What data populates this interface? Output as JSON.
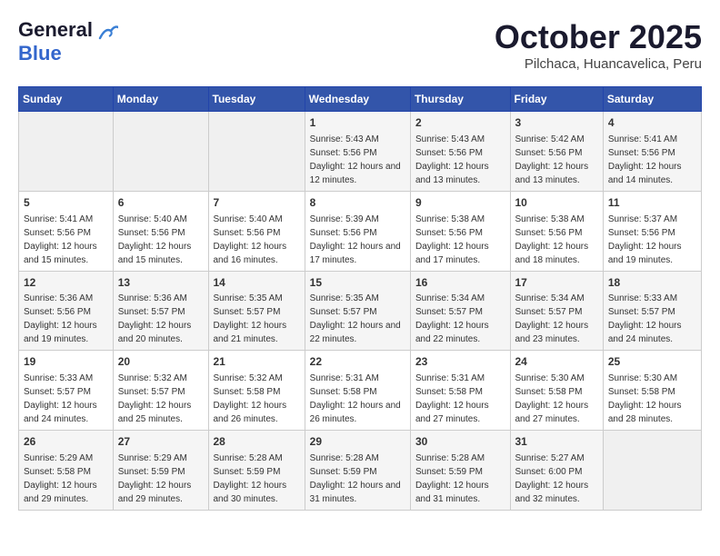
{
  "header": {
    "logo_general": "General",
    "logo_blue": "Blue",
    "month_year": "October 2025",
    "location": "Pilchaca, Huancavelica, Peru"
  },
  "weekdays": [
    "Sunday",
    "Monday",
    "Tuesday",
    "Wednesday",
    "Thursday",
    "Friday",
    "Saturday"
  ],
  "weeks": [
    [
      {
        "day": "",
        "sunrise": "",
        "sunset": "",
        "daylight": ""
      },
      {
        "day": "",
        "sunrise": "",
        "sunset": "",
        "daylight": ""
      },
      {
        "day": "",
        "sunrise": "",
        "sunset": "",
        "daylight": ""
      },
      {
        "day": "1",
        "sunrise": "Sunrise: 5:43 AM",
        "sunset": "Sunset: 5:56 PM",
        "daylight": "Daylight: 12 hours and 12 minutes."
      },
      {
        "day": "2",
        "sunrise": "Sunrise: 5:43 AM",
        "sunset": "Sunset: 5:56 PM",
        "daylight": "Daylight: 12 hours and 13 minutes."
      },
      {
        "day": "3",
        "sunrise": "Sunrise: 5:42 AM",
        "sunset": "Sunset: 5:56 PM",
        "daylight": "Daylight: 12 hours and 13 minutes."
      },
      {
        "day": "4",
        "sunrise": "Sunrise: 5:41 AM",
        "sunset": "Sunset: 5:56 PM",
        "daylight": "Daylight: 12 hours and 14 minutes."
      }
    ],
    [
      {
        "day": "5",
        "sunrise": "Sunrise: 5:41 AM",
        "sunset": "Sunset: 5:56 PM",
        "daylight": "Daylight: 12 hours and 15 minutes."
      },
      {
        "day": "6",
        "sunrise": "Sunrise: 5:40 AM",
        "sunset": "Sunset: 5:56 PM",
        "daylight": "Daylight: 12 hours and 15 minutes."
      },
      {
        "day": "7",
        "sunrise": "Sunrise: 5:40 AM",
        "sunset": "Sunset: 5:56 PM",
        "daylight": "Daylight: 12 hours and 16 minutes."
      },
      {
        "day": "8",
        "sunrise": "Sunrise: 5:39 AM",
        "sunset": "Sunset: 5:56 PM",
        "daylight": "Daylight: 12 hours and 17 minutes."
      },
      {
        "day": "9",
        "sunrise": "Sunrise: 5:38 AM",
        "sunset": "Sunset: 5:56 PM",
        "daylight": "Daylight: 12 hours and 17 minutes."
      },
      {
        "day": "10",
        "sunrise": "Sunrise: 5:38 AM",
        "sunset": "Sunset: 5:56 PM",
        "daylight": "Daylight: 12 hours and 18 minutes."
      },
      {
        "day": "11",
        "sunrise": "Sunrise: 5:37 AM",
        "sunset": "Sunset: 5:56 PM",
        "daylight": "Daylight: 12 hours and 19 minutes."
      }
    ],
    [
      {
        "day": "12",
        "sunrise": "Sunrise: 5:36 AM",
        "sunset": "Sunset: 5:56 PM",
        "daylight": "Daylight: 12 hours and 19 minutes."
      },
      {
        "day": "13",
        "sunrise": "Sunrise: 5:36 AM",
        "sunset": "Sunset: 5:57 PM",
        "daylight": "Daylight: 12 hours and 20 minutes."
      },
      {
        "day": "14",
        "sunrise": "Sunrise: 5:35 AM",
        "sunset": "Sunset: 5:57 PM",
        "daylight": "Daylight: 12 hours and 21 minutes."
      },
      {
        "day": "15",
        "sunrise": "Sunrise: 5:35 AM",
        "sunset": "Sunset: 5:57 PM",
        "daylight": "Daylight: 12 hours and 22 minutes."
      },
      {
        "day": "16",
        "sunrise": "Sunrise: 5:34 AM",
        "sunset": "Sunset: 5:57 PM",
        "daylight": "Daylight: 12 hours and 22 minutes."
      },
      {
        "day": "17",
        "sunrise": "Sunrise: 5:34 AM",
        "sunset": "Sunset: 5:57 PM",
        "daylight": "Daylight: 12 hours and 23 minutes."
      },
      {
        "day": "18",
        "sunrise": "Sunrise: 5:33 AM",
        "sunset": "Sunset: 5:57 PM",
        "daylight": "Daylight: 12 hours and 24 minutes."
      }
    ],
    [
      {
        "day": "19",
        "sunrise": "Sunrise: 5:33 AM",
        "sunset": "Sunset: 5:57 PM",
        "daylight": "Daylight: 12 hours and 24 minutes."
      },
      {
        "day": "20",
        "sunrise": "Sunrise: 5:32 AM",
        "sunset": "Sunset: 5:57 PM",
        "daylight": "Daylight: 12 hours and 25 minutes."
      },
      {
        "day": "21",
        "sunrise": "Sunrise: 5:32 AM",
        "sunset": "Sunset: 5:58 PM",
        "daylight": "Daylight: 12 hours and 26 minutes."
      },
      {
        "day": "22",
        "sunrise": "Sunrise: 5:31 AM",
        "sunset": "Sunset: 5:58 PM",
        "daylight": "Daylight: 12 hours and 26 minutes."
      },
      {
        "day": "23",
        "sunrise": "Sunrise: 5:31 AM",
        "sunset": "Sunset: 5:58 PM",
        "daylight": "Daylight: 12 hours and 27 minutes."
      },
      {
        "day": "24",
        "sunrise": "Sunrise: 5:30 AM",
        "sunset": "Sunset: 5:58 PM",
        "daylight": "Daylight: 12 hours and 27 minutes."
      },
      {
        "day": "25",
        "sunrise": "Sunrise: 5:30 AM",
        "sunset": "Sunset: 5:58 PM",
        "daylight": "Daylight: 12 hours and 28 minutes."
      }
    ],
    [
      {
        "day": "26",
        "sunrise": "Sunrise: 5:29 AM",
        "sunset": "Sunset: 5:58 PM",
        "daylight": "Daylight: 12 hours and 29 minutes."
      },
      {
        "day": "27",
        "sunrise": "Sunrise: 5:29 AM",
        "sunset": "Sunset: 5:59 PM",
        "daylight": "Daylight: 12 hours and 29 minutes."
      },
      {
        "day": "28",
        "sunrise": "Sunrise: 5:28 AM",
        "sunset": "Sunset: 5:59 PM",
        "daylight": "Daylight: 12 hours and 30 minutes."
      },
      {
        "day": "29",
        "sunrise": "Sunrise: 5:28 AM",
        "sunset": "Sunset: 5:59 PM",
        "daylight": "Daylight: 12 hours and 31 minutes."
      },
      {
        "day": "30",
        "sunrise": "Sunrise: 5:28 AM",
        "sunset": "Sunset: 5:59 PM",
        "daylight": "Daylight: 12 hours and 31 minutes."
      },
      {
        "day": "31",
        "sunrise": "Sunrise: 5:27 AM",
        "sunset": "Sunset: 6:00 PM",
        "daylight": "Daylight: 12 hours and 32 minutes."
      },
      {
        "day": "",
        "sunrise": "",
        "sunset": "",
        "daylight": ""
      }
    ]
  ]
}
